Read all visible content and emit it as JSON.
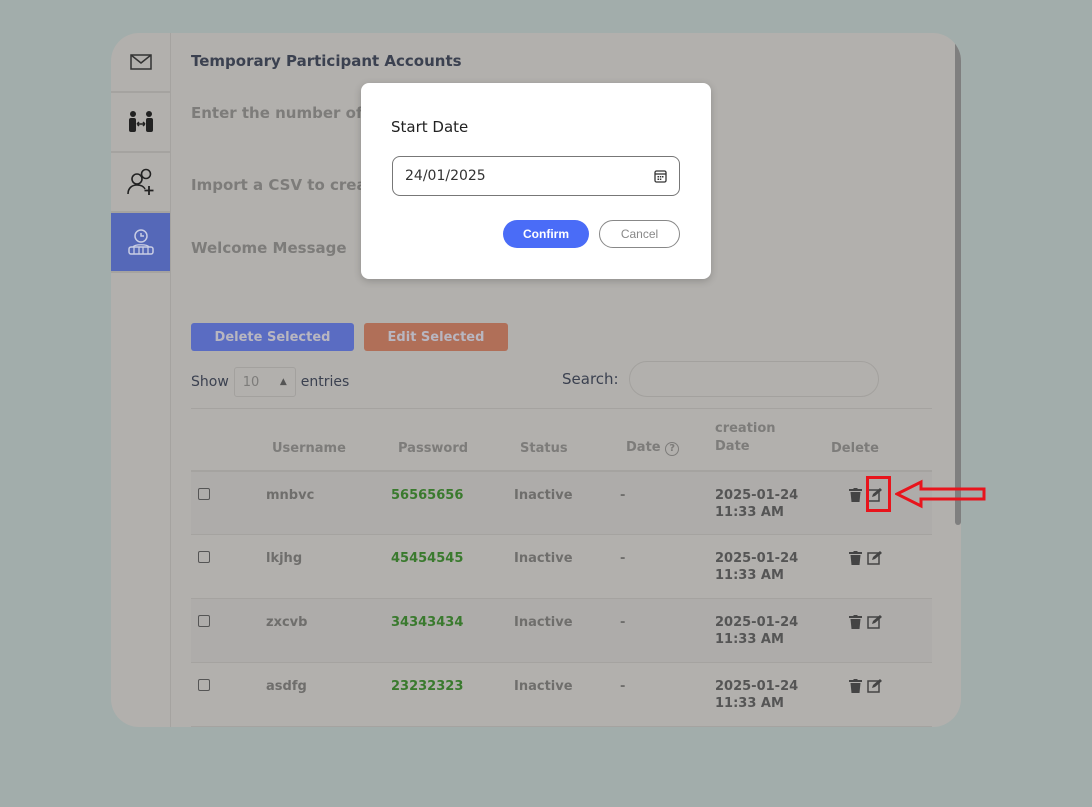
{
  "sidebar": {
    "items": [
      {
        "icon": "mail-icon"
      },
      {
        "icon": "participants-exchange-icon"
      },
      {
        "icon": "add-user-icon"
      },
      {
        "icon": "temporary-accounts-icon",
        "active": true
      }
    ]
  },
  "page": {
    "title": "Temporary Participant Accounts",
    "number_label": "Enter the number of a",
    "csv_label": "Import a CSV to creat",
    "welcome_label": "Welcome Message"
  },
  "toolbar": {
    "delete_selected": "Delete Selected",
    "edit_selected": "Edit Selected"
  },
  "entries": {
    "show": "Show",
    "value": "10",
    "entries": "entries"
  },
  "search": {
    "label": "Search:",
    "value": ""
  },
  "table": {
    "headers": [
      "",
      "Username",
      "Password",
      "Status",
      "Date",
      "creation Date",
      "Delete"
    ],
    "rows": [
      {
        "username": "mnbvc",
        "password": "56565656",
        "status": "Inactive",
        "date": "-",
        "created_date": "2025-01-24",
        "created_time": "11:33 AM"
      },
      {
        "username": "lkjhg",
        "password": "45454545",
        "status": "Inactive",
        "date": "-",
        "created_date": "2025-01-24",
        "created_time": "11:33 AM"
      },
      {
        "username": "zxcvb",
        "password": "34343434",
        "status": "Inactive",
        "date": "-",
        "created_date": "2025-01-24",
        "created_time": "11:33 AM"
      },
      {
        "username": "asdfg",
        "password": "23232323",
        "status": "Inactive",
        "date": "-",
        "created_date": "2025-01-24",
        "created_time": "11:33 AM"
      }
    ]
  },
  "modal": {
    "title": "Start Date",
    "date_value": "24/01/2025",
    "confirm": "Confirm",
    "cancel": "Cancel"
  },
  "colors": {
    "accent": "#4a6cf7",
    "annotation": "#e8141c",
    "password": "#3a7a2e"
  }
}
